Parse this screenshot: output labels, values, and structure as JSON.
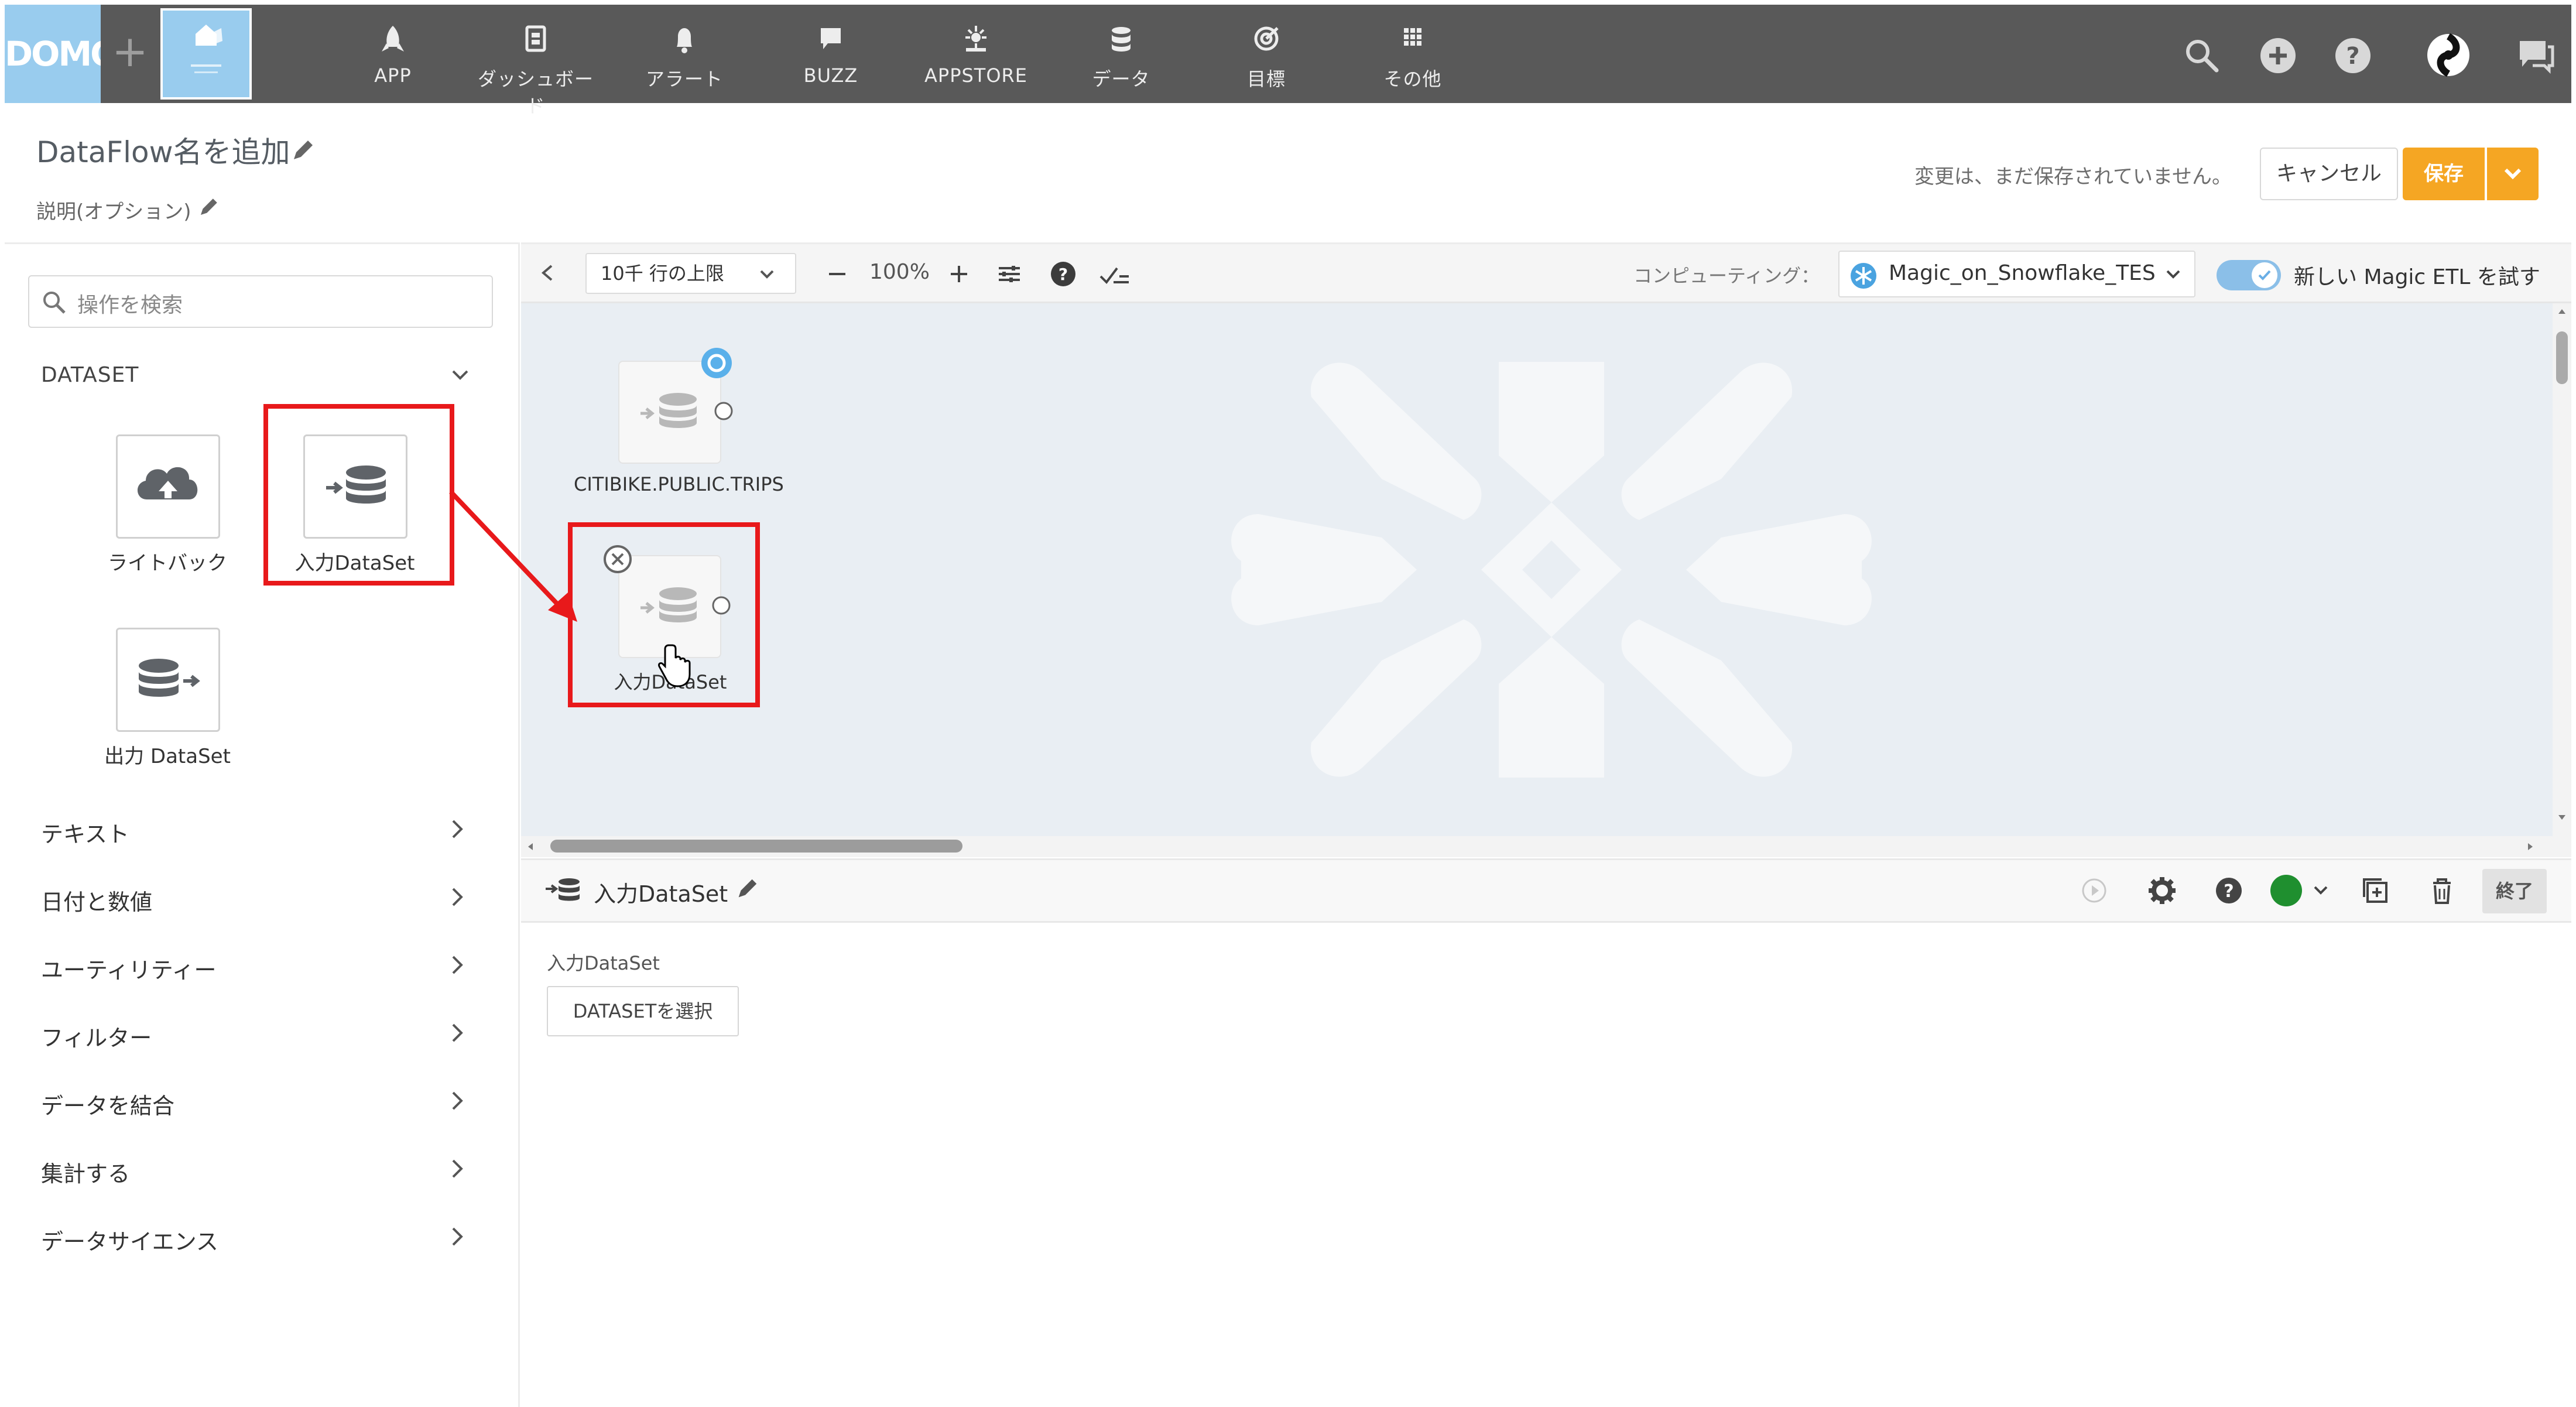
{
  "topbar": {
    "logo": "DOMO",
    "nav": [
      {
        "label": "APP",
        "icon": "rocket-icon"
      },
      {
        "label": "ダッシュボード",
        "icon": "dashboard-icon"
      },
      {
        "label": "アラート",
        "icon": "bell-icon"
      },
      {
        "label": "BUZZ",
        "icon": "chat-icon"
      },
      {
        "label": "APPSTORE",
        "icon": "appstore-icon"
      },
      {
        "label": "データ",
        "icon": "database-icon"
      },
      {
        "label": "目標",
        "icon": "target-icon"
      },
      {
        "label": "その他",
        "icon": "grid-icon"
      }
    ]
  },
  "header": {
    "title": "DataFlow名を追加",
    "description": "説明(オプション)",
    "unsaved": "変更は、まだ保存されていません。",
    "cancel": "キャンセル",
    "save": "保存"
  },
  "sidebar": {
    "search_placeholder": "操作を検索",
    "section": "DATASET",
    "tiles": [
      {
        "label": "ライトバック",
        "icon": "cloud-upload-icon"
      },
      {
        "label": "入力DataSet",
        "icon": "input-dataset-icon"
      },
      {
        "label": "出力 DataSet",
        "icon": "output-dataset-icon"
      }
    ],
    "categories": [
      "テキスト",
      "日付と数値",
      "ユーティリティー",
      "フィルター",
      "データを結合",
      "集計する",
      "データサイエンス"
    ]
  },
  "toolbar": {
    "row_limit": "10千 行の上限",
    "zoom": "100%",
    "compute_label": "コンピューティング：",
    "compute_value": "Magic_on_Snowflake_TES",
    "try_new": "新しい Magic ETL を試す"
  },
  "canvas": {
    "nodes": [
      {
        "label": "CITIBIKE.PUBLIC.TRIPS"
      },
      {
        "label": "入力DataSet"
      }
    ]
  },
  "detail": {
    "title": "入力DataSet",
    "subtitle": "入力DataSet",
    "select_button": "DATASETを選択",
    "end_button": "終了"
  },
  "colors": {
    "topbar": "#595959",
    "accent": "#99ccee",
    "save": "#f5a623",
    "highlight": "#e8191b",
    "status_green": "#1f8f2f"
  }
}
